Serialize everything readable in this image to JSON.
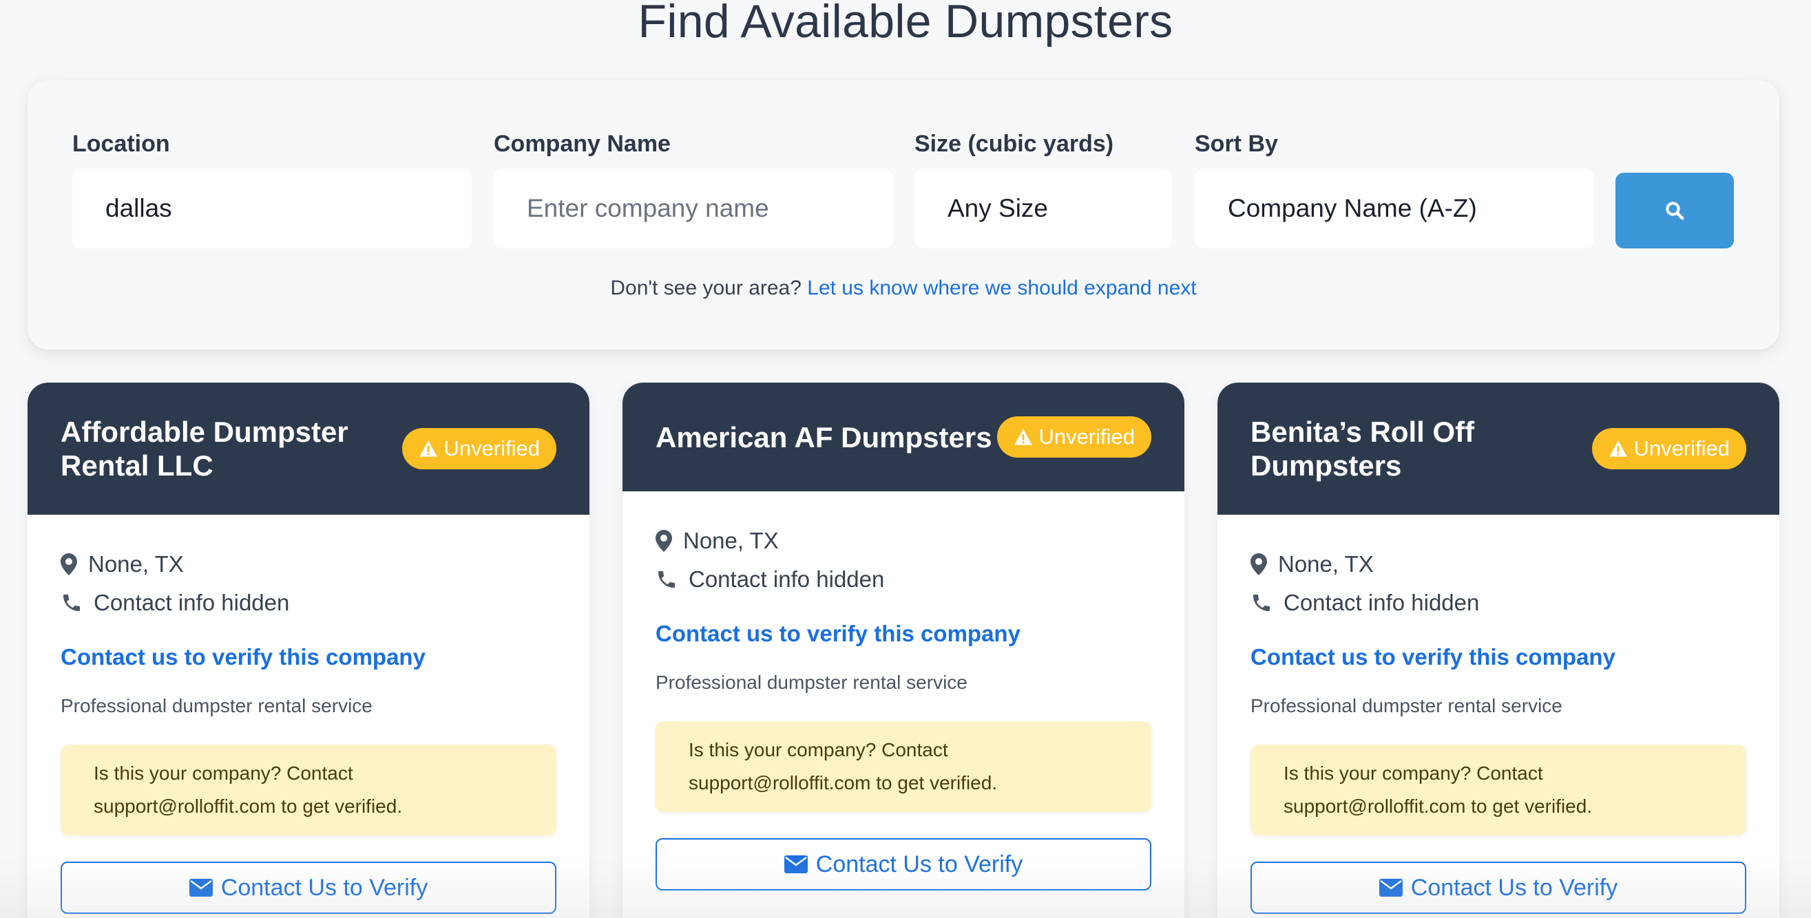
{
  "page": {
    "title": "Find Available Dumpsters"
  },
  "search": {
    "location": {
      "label": "Location",
      "value": "dallas"
    },
    "company": {
      "label": "Company Name",
      "placeholder": "Enter company name"
    },
    "size": {
      "label": "Size (cubic yards)",
      "value": "Any Size"
    },
    "sort": {
      "label": "Sort By",
      "value": "Company Name (A-Z)"
    },
    "search_button_icon": "search-icon",
    "expand_text": "Don't see your area?",
    "expand_link": "Let us know where we should expand next"
  },
  "colors": {
    "header_bg": "#2d3a4e",
    "badge": "#fbbf24",
    "accent_blue": "#1a6fe0",
    "search_button": "#3c97d8",
    "notice_bg": "#fef3c7"
  },
  "cards": [
    {
      "title": "Affordable Dumpster Rental LLC",
      "badge": "Unverified",
      "location": "None, TX",
      "contact": "Contact info hidden",
      "verify_link": "Contact us to verify this company",
      "description": "Professional dumpster rental service",
      "notice": "Is this your company? Contact support@rolloffit.com to get verified.",
      "button": "Contact Us to Verify"
    },
    {
      "title": "American AF Dumpsters",
      "badge": "Unverified",
      "location": "None, TX",
      "contact": "Contact info hidden",
      "verify_link": "Contact us to verify this company",
      "description": "Professional dumpster rental service",
      "notice": "Is this your company? Contact support@rolloffit.com to get verified.",
      "button": "Contact Us to Verify"
    },
    {
      "title": "Benita’s Roll Off Dumpsters",
      "badge": "Unverified",
      "location": "None, TX",
      "contact": "Contact info hidden",
      "verify_link": "Contact us to verify this company",
      "description": "Professional dumpster rental service",
      "notice": "Is this your company? Contact support@rolloffit.com to get verified.",
      "button": "Contact Us to Verify"
    }
  ]
}
